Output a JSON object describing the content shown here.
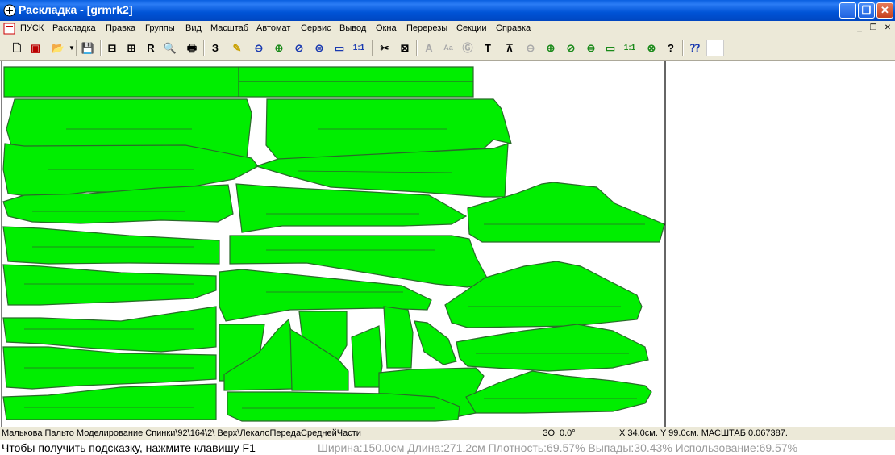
{
  "window": {
    "title": "Раскладка - [grmrk2]"
  },
  "menu": [
    "ПУСК",
    "Раскладка",
    "Правка",
    "Группы",
    "Вид",
    "Масштаб",
    "Автомат",
    "Сервис",
    "Вывод",
    "Окна",
    "Перерезы",
    "Секции",
    "Справка"
  ],
  "toolbar": {
    "z_label": "З",
    "r_label": "R",
    "a_label": "A",
    "t_label": "T",
    "one_to_one": "1:1",
    "help_glyph": "?"
  },
  "status": {
    "piece_info": "Малькова Пальто Моделирование Спинки\\92\\164\\2\\ Верх\\ЛекалоПередаСреднейЧасти",
    "mode": "ЗО",
    "angle": "0.0°",
    "coords": "X 34.0см.  Y 99.0см. МАСШТАБ 0.067387."
  },
  "hint": "Чтобы получить подсказку, нажмите клавишу F1",
  "stats": "Ширина:150.0см Длина:271.2см Плотность:69.57% Выпады:30.43% Использование:69.57%",
  "colors": {
    "piece_fill": "#00ee00",
    "piece_stroke": "#2a6a2a",
    "titlebar": "#0053d6"
  }
}
